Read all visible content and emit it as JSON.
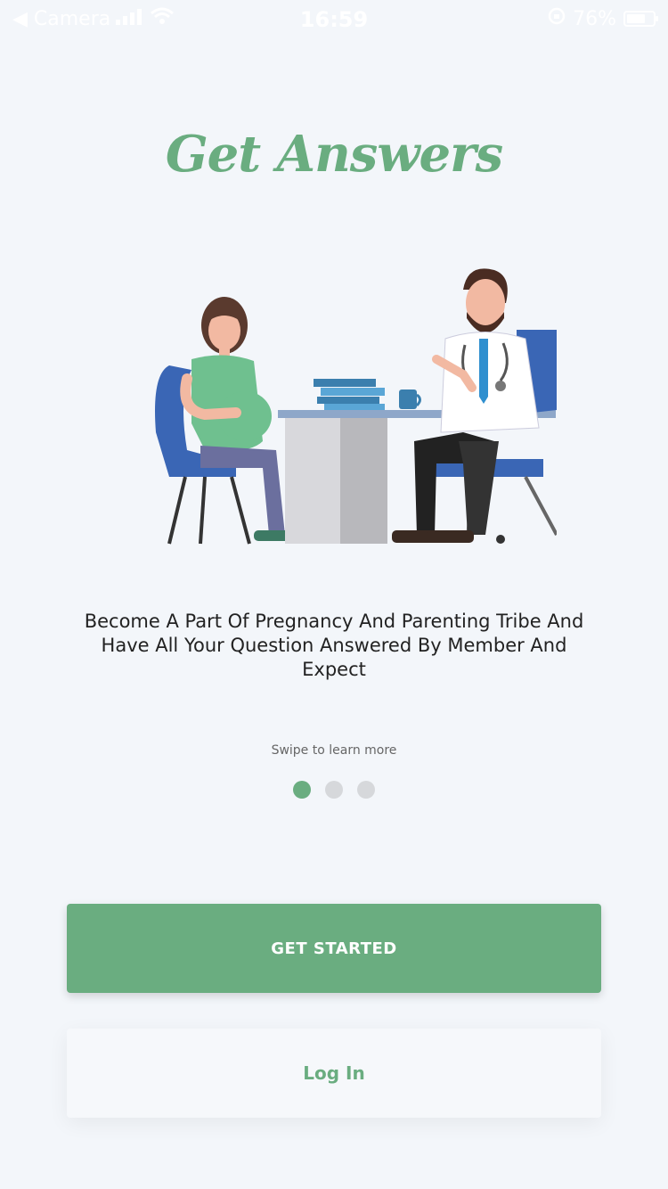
{
  "status_bar": {
    "back_label": "◀ Camera",
    "time": "16:59",
    "battery_percent": "76%",
    "battery_level": 0.76
  },
  "headline": "Get Answers",
  "illustration": {
    "icon": "doctor-consultation-illustration"
  },
  "description": "Become A Part Of Pregnancy And Parenting Tribe And Have All Your Question Answered By Member And Expect",
  "swipe_hint": "Swipe to learn more",
  "pagination": {
    "total": 3,
    "active": 0
  },
  "buttons": {
    "get_started": "GET STARTED",
    "log_in": "Log In"
  },
  "colors": {
    "accent": "#6aad80",
    "background": "#f3f6fa",
    "dot_inactive": "#d6d8db"
  }
}
